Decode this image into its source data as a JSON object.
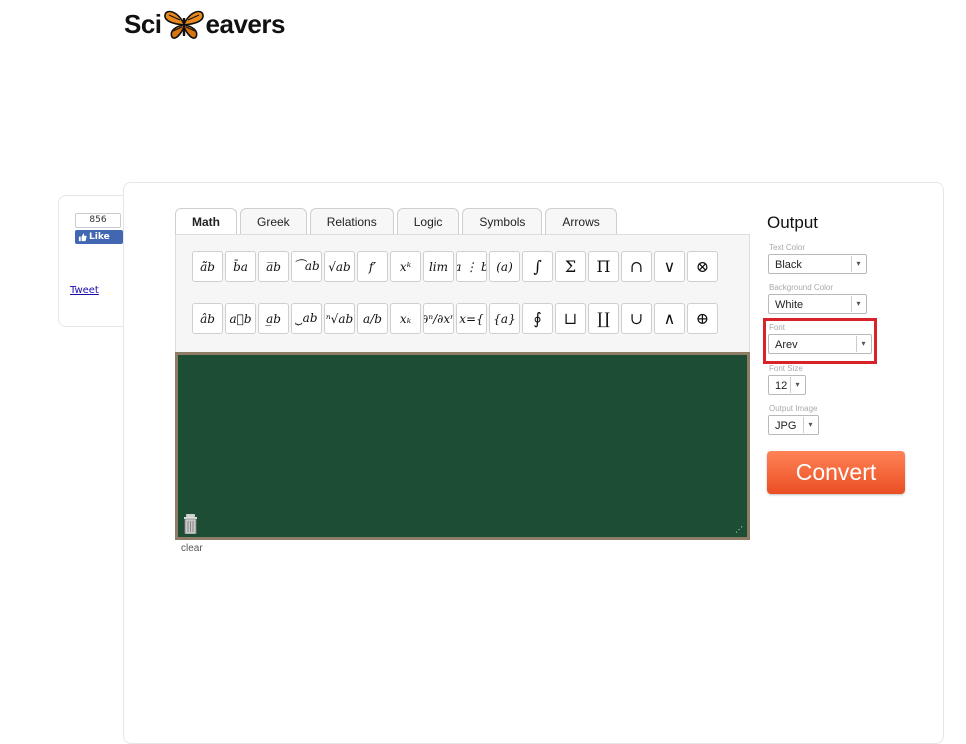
{
  "logo": {
    "left": "Sci",
    "right": "eavers"
  },
  "social": {
    "like_count": "856",
    "like_label": "Like",
    "tweet_label": "Tweet"
  },
  "tabs": [
    {
      "label": "Math"
    },
    {
      "label": "Greek"
    },
    {
      "label": "Relations"
    },
    {
      "label": "Logic"
    },
    {
      "label": "Symbols"
    },
    {
      "label": "Arrows"
    }
  ],
  "toolbar": {
    "row1": [
      "ã̃b",
      "b̄a",
      "a̅b",
      "⏜ab",
      "√ab",
      "f′",
      "xᵏ",
      "lim",
      "[a ⋮ b]",
      "(a)",
      "∫",
      "Σ",
      "Π",
      "∩",
      "∨",
      "⊗"
    ],
    "row2": [
      "âb",
      "a⃗b",
      "a̲b",
      "⏟ab",
      "ⁿ√ab",
      "a/b",
      "xₖ",
      "∂ⁿ/∂xⁿ",
      "x={",
      "{a}",
      "∮",
      "⊔",
      "∐",
      "∪",
      "∧",
      "⊕"
    ]
  },
  "editor": {
    "clear_label": "clear"
  },
  "output": {
    "title": "Output",
    "text_color": {
      "label": "Text Color",
      "value": "Black"
    },
    "background_color": {
      "label": "Background Color",
      "value": "White"
    },
    "font": {
      "label": "Font",
      "value": "Arev"
    },
    "font_size": {
      "label": "Font Size",
      "value": "12"
    },
    "output_image": {
      "label": "Output Image",
      "value": "JPG"
    },
    "convert_label": "Convert"
  },
  "colors": {
    "accent": "#ea4e23",
    "board": "#1e4d36",
    "highlight": "#d8232a",
    "facebook": "#4267b2"
  }
}
